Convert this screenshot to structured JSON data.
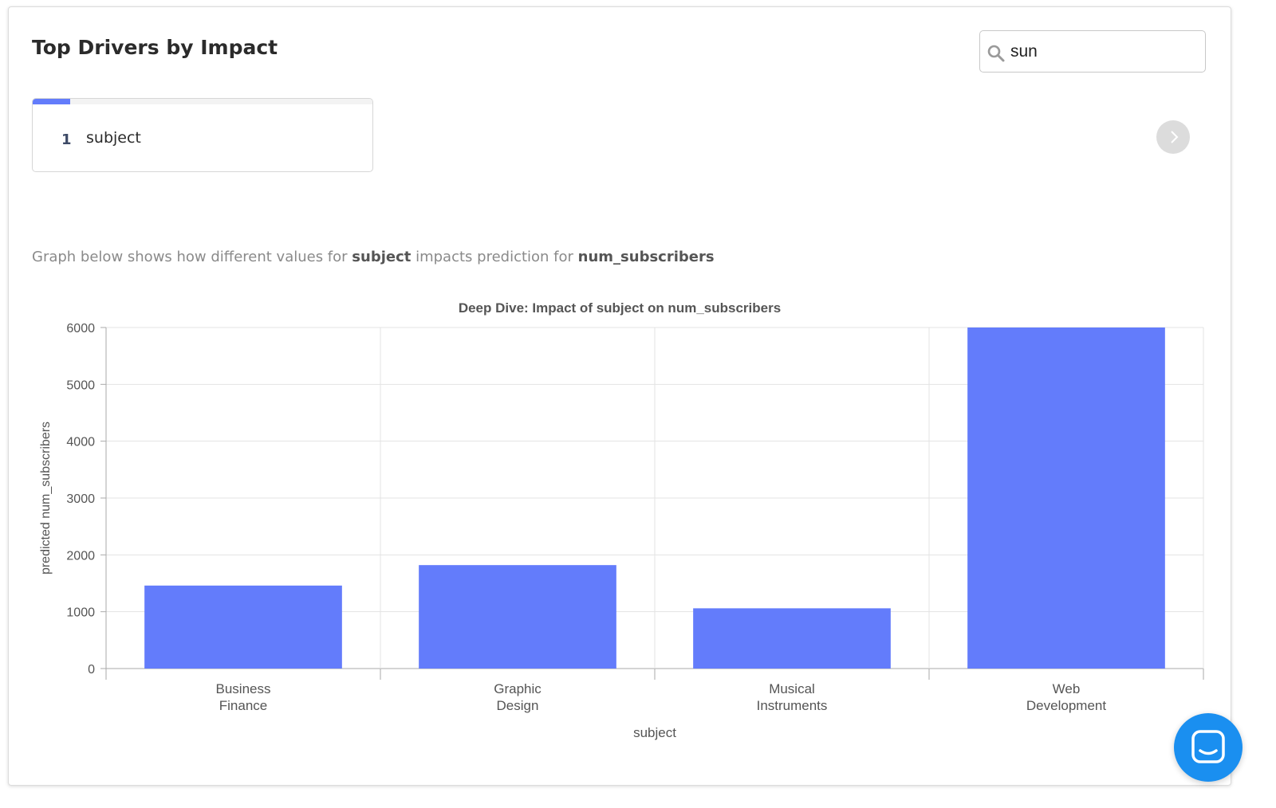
{
  "header": {
    "title": "Top Drivers by Impact"
  },
  "search": {
    "value": "sun",
    "icon": "search-icon"
  },
  "drivers": [
    {
      "rank": "1",
      "name": "subject",
      "impact_fraction": 0.11
    }
  ],
  "description": {
    "prefix": "Graph below shows how different values for ",
    "feature": "subject",
    "middle": " impacts prediction for ",
    "target": "num_subscribers"
  },
  "colors": {
    "accent": "#637cfb",
    "chat_button": "#1a8ff0"
  },
  "chart_data": {
    "type": "bar",
    "title": "Deep Dive: Impact of subject on num_subscribers",
    "xlabel": "subject",
    "ylabel": "predicted num_subscribers",
    "categories": [
      [
        "Business",
        "Finance"
      ],
      [
        "Graphic",
        "Design"
      ],
      [
        "Musical",
        "Instruments"
      ],
      [
        "Web",
        "Development"
      ]
    ],
    "values": [
      1460,
      1820,
      1060,
      6000
    ],
    "ylim": [
      0,
      6000
    ],
    "yticks": [
      "0",
      "1000",
      "2000",
      "3000",
      "4000",
      "5000",
      "6000"
    ],
    "grid": true
  }
}
